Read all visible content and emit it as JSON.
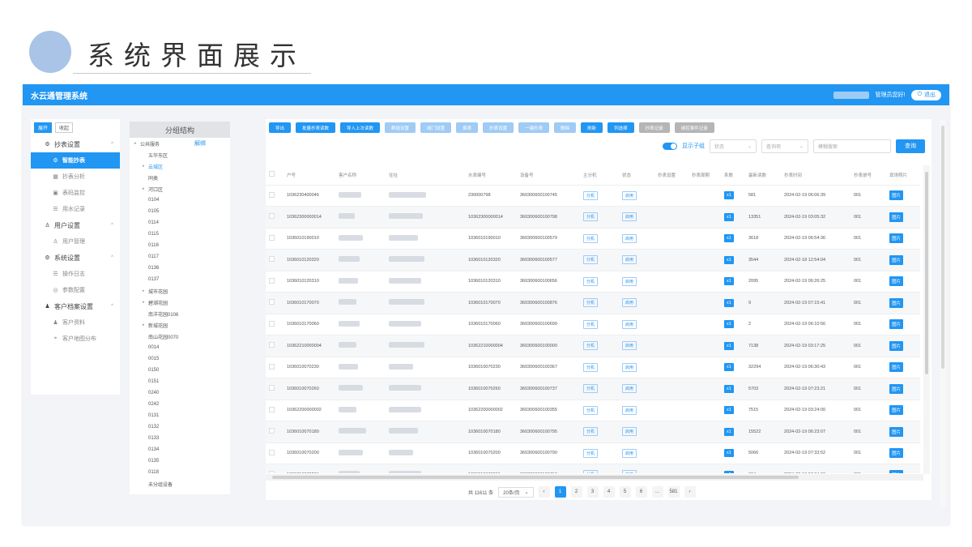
{
  "slide": {
    "title": "系统界面展示"
  },
  "app": {
    "name": "水云通管理系统",
    "greeting": "管理员您好!",
    "logout": "退出"
  },
  "sidebar": {
    "tabs": [
      "展开",
      "收起"
    ],
    "groups": [
      {
        "icon": "gear-icon",
        "label": "抄表设置",
        "items": [
          {
            "icon": "gear-icon",
            "label": "智能抄表",
            "active": true
          },
          {
            "icon": "analysis-icon",
            "label": "抄表分析"
          },
          {
            "icon": "monitor-icon",
            "label": "表码监控"
          },
          {
            "icon": "record-icon",
            "label": "用水记录"
          }
        ]
      },
      {
        "icon": "user-icon",
        "label": "用户设置",
        "items": [
          {
            "icon": "user-icon",
            "label": "用户管理"
          }
        ]
      },
      {
        "icon": "settings-icon",
        "label": "系统设置",
        "items": [
          {
            "icon": "log-icon",
            "label": "操作日志"
          },
          {
            "icon": "param-icon",
            "label": "参数配置"
          }
        ]
      },
      {
        "icon": "person-icon",
        "label": "客户档案设置",
        "items": [
          {
            "icon": "person-icon",
            "label": "客户资料"
          },
          {
            "icon": "map-icon",
            "label": "客户地图分布"
          }
        ]
      }
    ]
  },
  "tree": {
    "title": "分组结构",
    "unbind": "解绑",
    "rows": [
      {
        "label": "公共服务",
        "arrow": true
      },
      {
        "label": "五华东区",
        "indent": 1
      },
      {
        "label": "云城区",
        "arrow": true,
        "indent": 1,
        "selected": true
      },
      {
        "label": "同类",
        "indent": 1
      },
      {
        "label": "河口区",
        "arrow": true,
        "indent": 1
      },
      {
        "label": "0104",
        "indent": 1
      },
      {
        "label": "0105",
        "indent": 1
      },
      {
        "label": "0114",
        "indent": 1
      },
      {
        "label": "0115",
        "indent": 1
      },
      {
        "label": "0116",
        "indent": 1
      },
      {
        "label": "0117",
        "indent": 1
      },
      {
        "label": "0136",
        "indent": 1
      },
      {
        "label": "0137",
        "indent": 1
      },
      {
        "label": "城市花园",
        "arrow": true,
        "indent": 1
      },
      {
        "label": "碧湖花园",
        "arrow": true,
        "indent": 1
      },
      {
        "label": "南洋花园0106",
        "indent": 1
      },
      {
        "label": "新城花园",
        "arrow": true,
        "indent": 1
      },
      {
        "label": "南山花园0070",
        "indent": 1
      },
      {
        "label": "0014",
        "indent": 1
      },
      {
        "label": "0015",
        "indent": 1
      },
      {
        "label": "0150",
        "indent": 1
      },
      {
        "label": "0151",
        "indent": 1
      },
      {
        "label": "0240",
        "indent": 1
      },
      {
        "label": "0242",
        "indent": 1
      },
      {
        "label": "0131",
        "indent": 1
      },
      {
        "label": "0132",
        "indent": 1
      },
      {
        "label": "0133",
        "indent": 1
      },
      {
        "label": "0134",
        "indent": 1
      },
      {
        "label": "0135",
        "indent": 1
      },
      {
        "label": "0118",
        "indent": 1
      },
      {
        "label": "未分组设备",
        "indent": 1
      }
    ]
  },
  "toolbar": {
    "buttons": [
      {
        "label": "导出",
        "state": "primary"
      },
      {
        "label": "批量抄表读数",
        "state": "primary"
      },
      {
        "label": "导入上次读数",
        "state": "primary"
      },
      {
        "label": "群组设置",
        "state": "disabled"
      },
      {
        "label": "阀门设置",
        "state": "disabled"
      },
      {
        "label": "换表",
        "state": "disabled"
      },
      {
        "label": "抄表设置",
        "state": "disabled"
      },
      {
        "label": "一键抄表",
        "state": "disabled"
      },
      {
        "label": "删除",
        "state": "disabled"
      },
      {
        "label": "刷新",
        "state": "primary"
      },
      {
        "label": "列选择",
        "state": "primary"
      },
      {
        "label": "抄表记录",
        "state": "grey"
      },
      {
        "label": "阀控事件记录",
        "state": "grey"
      }
    ]
  },
  "filters": {
    "toggle_label": "显示子组",
    "status_placeholder": "状态",
    "query_placeholder": "查询项",
    "keyword_placeholder": "模糊搜索",
    "search": "查询"
  },
  "table": {
    "columns": [
      "户号",
      "客户名称",
      "住址",
      "水表编号",
      "设备号",
      "主分机",
      "状态",
      "抄表设置",
      "抄表周期",
      "系数",
      "最新读数",
      "抄表时间",
      "抄表册号",
      "现场照片"
    ],
    "rows": [
      {
        "account": "1036230400046",
        "meter": "230000798",
        "device": "360300600100745",
        "reading": "581",
        "time": "2024-02-19 06:06:39",
        "book": "001"
      },
      {
        "account": "10362300000014",
        "meter": "10362300000014",
        "device": "360300600100798",
        "reading": "13351",
        "time": "2024-02-19 03:05:32",
        "book": "001"
      },
      {
        "account": "1036010190010",
        "meter": "1036010190010",
        "device": "360300600100579",
        "reading": "3618",
        "time": "2024-02-19 06:54:36",
        "book": "001"
      },
      {
        "account": "1036010120320",
        "meter": "1036010120320",
        "device": "360300600100577",
        "reading": "3544",
        "time": "2024-02-18 12:54:04",
        "book": "001"
      },
      {
        "account": "1036010120310",
        "meter": "1036010120310",
        "device": "360300600100656",
        "reading": "2095",
        "time": "2024-02-19 06:26:25",
        "book": "001"
      },
      {
        "account": "1036010170070",
        "meter": "1036010170070",
        "device": "360300600100876",
        "reading": "9",
        "time": "2024-02-19 07:15:41",
        "book": "001"
      },
      {
        "account": "1036010170060",
        "meter": "1036010170060",
        "device": "360300600100699",
        "reading": "2",
        "time": "2024-02-19 06:10:56",
        "book": "001"
      },
      {
        "account": "10362210000004",
        "meter": "10362210000004",
        "device": "360300600100000",
        "reading": "7138",
        "time": "2024-02-19 03:17:25",
        "book": "001"
      },
      {
        "account": "1036010070230",
        "meter": "1036010070230",
        "device": "360300600100367",
        "reading": "32294",
        "time": "2024-02-19 06:30:43",
        "book": "001"
      },
      {
        "account": "1036010070260",
        "meter": "1036010070260",
        "device": "360300600100737",
        "reading": "5703",
        "time": "2024-02-19 07:23:21",
        "book": "001"
      },
      {
        "account": "10362200000002",
        "meter": "10362200000002",
        "device": "360300600100355",
        "reading": "7515",
        "time": "2024-02-19 03:24:00",
        "book": "001"
      },
      {
        "account": "1036010070180",
        "meter": "1036010070180",
        "device": "360300600100795",
        "reading": "15522",
        "time": "2024-02-19 06:23:07",
        "book": "001"
      },
      {
        "account": "1036010070200",
        "meter": "1036010070200",
        "device": "360300600100790",
        "reading": "5066",
        "time": "2024-02-19 07:33:52",
        "book": "001"
      },
      {
        "account": "1036010070201",
        "meter": "1036010070201",
        "device": "360300600100713",
        "reading": "834",
        "time": "2024-02-19 07:34:00",
        "book": "001"
      }
    ],
    "submeter_label": "分机",
    "status_label": "启用",
    "factor_label": "x1",
    "photo_label": "图片"
  },
  "pagination": {
    "total": "共 11611 条",
    "page_size": "20条/页",
    "pages": [
      "1",
      "2",
      "3",
      "4",
      "5",
      "6",
      "...",
      "581"
    ],
    "current": "1"
  }
}
